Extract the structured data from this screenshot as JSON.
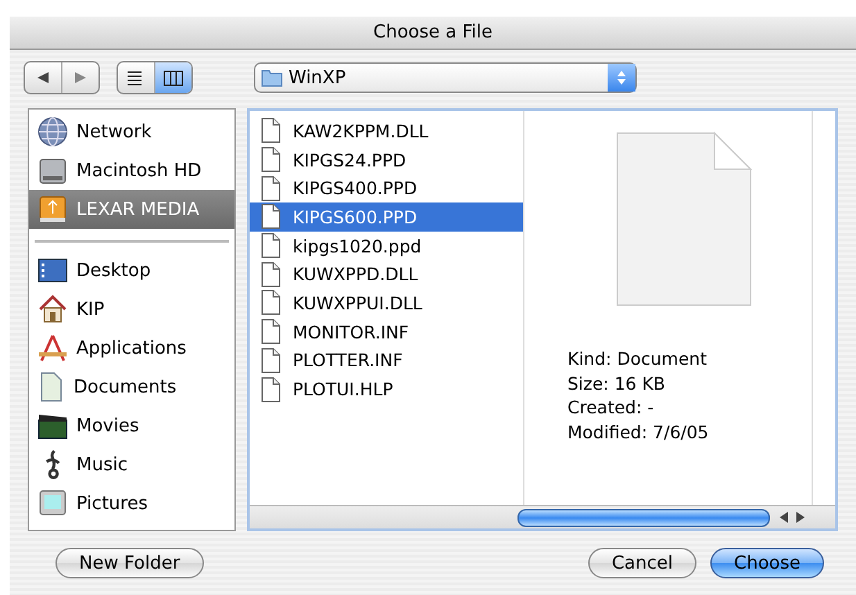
{
  "window": {
    "title": "Choose a File"
  },
  "toolbar": {
    "view_modes": [
      {
        "selected": false
      },
      {
        "selected": true
      }
    ],
    "location": "WinXP"
  },
  "sidebar": {
    "sections": [
      {
        "items": [
          {
            "label": "Network",
            "selected": false
          },
          {
            "label": "Macintosh HD",
            "selected": false
          },
          {
            "label": "LEXAR MEDIA",
            "selected": true
          }
        ]
      },
      {
        "items": [
          {
            "label": "Desktop",
            "selected": false
          },
          {
            "label": "KIP",
            "selected": false
          },
          {
            "label": "Applications",
            "selected": false
          },
          {
            "label": "Documents",
            "selected": false
          },
          {
            "label": "Movies",
            "selected": false
          },
          {
            "label": "Music",
            "selected": false
          },
          {
            "label": "Pictures",
            "selected": false
          }
        ]
      }
    ]
  },
  "files": [
    {
      "name": "KAW2KPPM.DLL",
      "selected": false
    },
    {
      "name": "KIPGS24.PPD",
      "selected": false
    },
    {
      "name": "KIPGS400.PPD",
      "selected": false
    },
    {
      "name": "KIPGS600.PPD",
      "selected": true
    },
    {
      "name": "kipgs1020.ppd",
      "selected": false
    },
    {
      "name": "KUWXPPD.DLL",
      "selected": false
    },
    {
      "name": "KUWXPPUI.DLL",
      "selected": false
    },
    {
      "name": "MONITOR.INF",
      "selected": false
    },
    {
      "name": "PLOTTER.INF",
      "selected": false
    },
    {
      "name": "PLOTUI.HLP",
      "selected": false
    }
  ],
  "preview": {
    "info": [
      "Kind: Document",
      "Size: 16 KB",
      "Created: -",
      "Modified: 7/6/05"
    ]
  },
  "buttons": [
    {
      "label": "New Folder",
      "kind": "normal"
    },
    {
      "label": "Cancel",
      "kind": "normal"
    },
    {
      "label": "Choose",
      "kind": "default"
    }
  ]
}
